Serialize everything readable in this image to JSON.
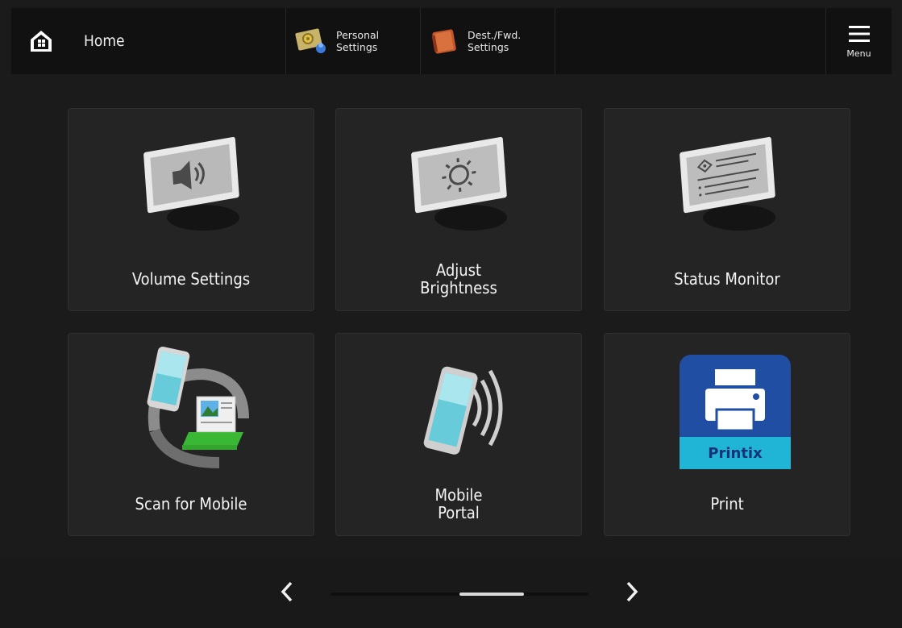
{
  "header": {
    "home_title": "Home",
    "personal_settings_label": "Personal\nSettings",
    "dest_fwd_settings_label": "Dest./Fwd.\nSettings",
    "menu_label": "Menu"
  },
  "tiles": [
    {
      "label": "Volume Settings",
      "icon": "speaker-icon"
    },
    {
      "label": "Adjust\nBrightness",
      "icon": "sun-icon"
    },
    {
      "label": "Status Monitor",
      "icon": "status-icon"
    },
    {
      "label": "Scan for Mobile",
      "icon": "scan-mobile-icon"
    },
    {
      "label": "Mobile\nPortal",
      "icon": "mobile-portal-icon"
    },
    {
      "label": "Print",
      "icon": "printix-icon"
    }
  ],
  "printix_text": "Printix",
  "pagination": {
    "current": 2,
    "total": 4
  },
  "colors": {
    "background": "#1b1b1b",
    "tile": "#242424",
    "printix_blue": "#1f4ea3",
    "printix_teal": "#20b4d6"
  }
}
